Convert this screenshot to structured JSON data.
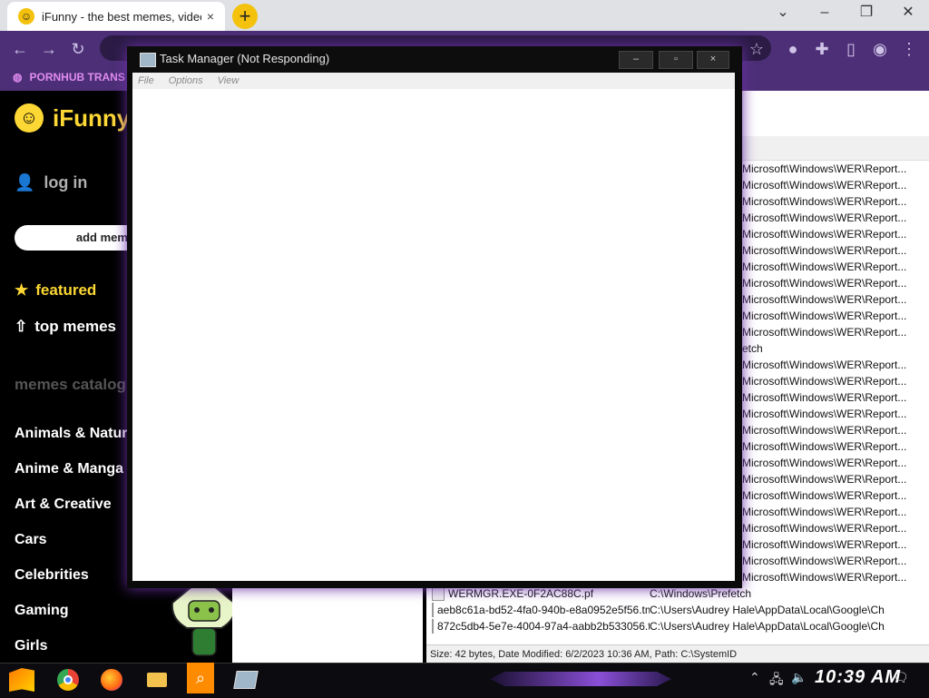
{
  "browser": {
    "tab_title": "iFunny - the best memes, videos",
    "tab_close": "×",
    "new_tab": "+",
    "bookmark_label": "PORNHUB TRANS"
  },
  "ifunny": {
    "logo_text": "iFunny",
    "login": "log in",
    "add_meme": "add meme",
    "featured": "featured",
    "top_memes": "top memes",
    "catalog_title": "memes catalog",
    "categories": [
      "Animals & Nature",
      "Anime & Manga",
      "Art & Creative",
      "Cars",
      "Celebrities",
      "Gaming",
      "Girls"
    ]
  },
  "task_manager": {
    "title": "Task Manager (Not Responding)",
    "menu": [
      "File",
      "Options",
      "View"
    ],
    "minimize": "–",
    "maximize": "▫",
    "close": "×"
  },
  "explorer": {
    "rows": [
      "Microsoft\\Windows\\WER\\Report...",
      "Microsoft\\Windows\\WER\\Report...",
      "Microsoft\\Windows\\WER\\Report...",
      "Microsoft\\Windows\\WER\\Report...",
      "Microsoft\\Windows\\WER\\Report...",
      "Microsoft\\Windows\\WER\\Report...",
      "Microsoft\\Windows\\WER\\Report...",
      "Microsoft\\Windows\\WER\\Report...",
      "Microsoft\\Windows\\WER\\Report...",
      "Microsoft\\Windows\\WER\\Report...",
      "Microsoft\\Windows\\WER\\Report...",
      "etch",
      "Microsoft\\Windows\\WER\\Report...",
      "Microsoft\\Windows\\WER\\Report...",
      "Microsoft\\Windows\\WER\\Report...",
      "Microsoft\\Windows\\WER\\Report...",
      "Microsoft\\Windows\\WER\\Report...",
      "Microsoft\\Windows\\WER\\Report...",
      "Microsoft\\Windows\\WER\\Report...",
      "Microsoft\\Windows\\WER\\Report...",
      "Microsoft\\Windows\\WER\\Report...",
      "Microsoft\\Windows\\WER\\Report...",
      "Microsoft\\Windows\\WER\\Report...",
      "Microsoft\\Windows\\WER\\Report...",
      "Microsoft\\Windows\\WER\\Report...",
      "Microsoft\\Windows\\WER\\Report..."
    ],
    "files": [
      {
        "name": "WERMGR.EXE-0F2AC88C.pf",
        "path": "C:\\Windows\\Prefetch"
      },
      {
        "name": "aeb8c61a-bd52-4fa0-940b-e8a0952e5f56.tm...",
        "path": "C:\\Users\\Audrey Hale\\AppData\\Local\\Google\\Ch..."
      },
      {
        "name": "872c5db4-5e7e-4004-97a4-aabb2b533056.t...",
        "path": "C:\\Users\\Audrey Hale\\AppData\\Local\\Google\\Ch..."
      }
    ],
    "status": "Size: 42 bytes, Date Modified: 6/2/2023 10:36 AM, Path: C:\\SystemID"
  },
  "taskbar": {
    "clock": "10:39 AM"
  }
}
